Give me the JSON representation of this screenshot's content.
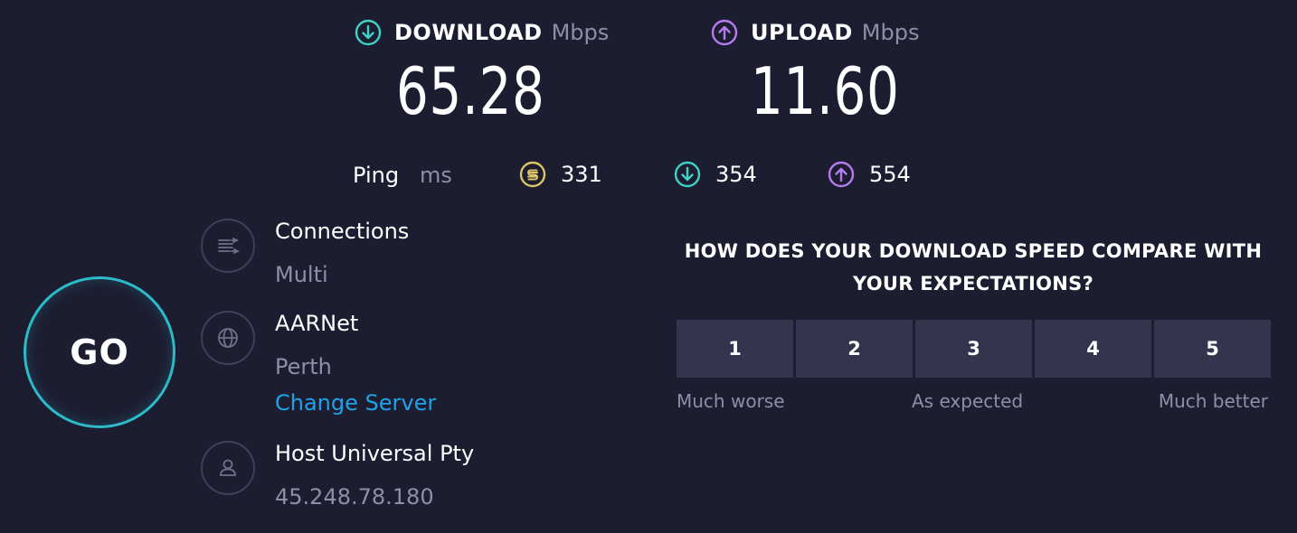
{
  "results": {
    "download": {
      "label": "DOWNLOAD",
      "unit": "Mbps",
      "value": "65.28",
      "icon": "download-arrow-icon",
      "color": "#3fd3c3"
    },
    "upload": {
      "label": "UPLOAD",
      "unit": "Mbps",
      "value": "11.60",
      "icon": "upload-arrow-icon",
      "color": "#b57cf0"
    }
  },
  "ping": {
    "label": "Ping",
    "unit": "ms",
    "idle": {
      "value": "331",
      "icon": "ping-idle-icon",
      "color": "#dcc468"
    },
    "download": {
      "value": "354",
      "icon": "download-arrow-icon",
      "color": "#3fd3c3"
    },
    "upload": {
      "value": "554",
      "icon": "upload-arrow-icon",
      "color": "#b57cf0"
    }
  },
  "go_button": {
    "label": "GO",
    "ring_color": "#2bbbc9"
  },
  "connections": {
    "title": "Connections",
    "value": "Multi",
    "icon": "connections-icon"
  },
  "server": {
    "name": "AARNet",
    "location": "Perth",
    "change_link": "Change Server",
    "icon": "globe-icon",
    "link_color": "#1ea2e8"
  },
  "isp": {
    "name": "Host Universal Pty",
    "ip": "45.248.78.180",
    "icon": "user-icon"
  },
  "survey": {
    "question": "HOW DOES YOUR DOWNLOAD SPEED COMPARE WITH YOUR EXPECTATIONS?",
    "ratings": [
      "1",
      "2",
      "3",
      "4",
      "5"
    ],
    "captions": {
      "low": "Much worse",
      "mid": "As expected",
      "high": "Much better"
    }
  }
}
